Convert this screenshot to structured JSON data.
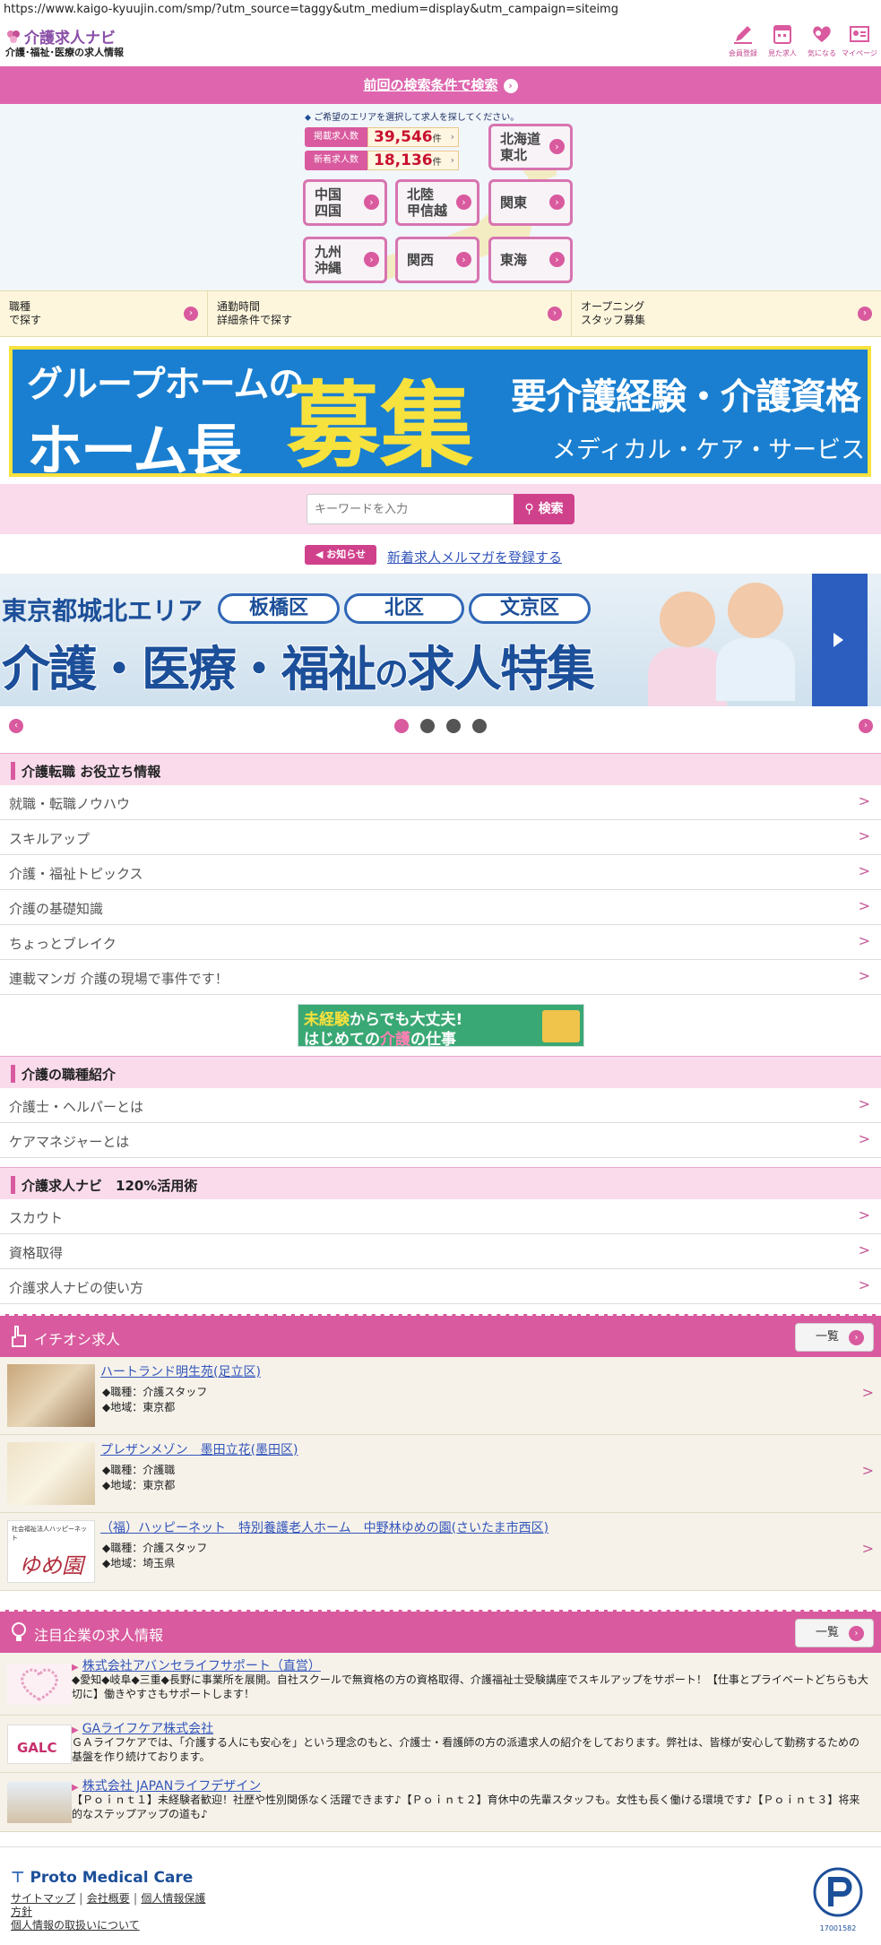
{
  "browser": {
    "url": "https://www.kaigo-kyuujin.com/smp/?utm_source=taggy&utm_medium=display&utm_campaign=siteimg"
  },
  "header": {
    "logo_title": "介護求人ナビ",
    "logo_sub": "介護･福祉･医療の求人情報",
    "icons": [
      {
        "icon": "pen-icon",
        "label": "会員登録"
      },
      {
        "icon": "calendar-icon",
        "label": "見た求人"
      },
      {
        "icon": "heart-icon",
        "label": "気になる"
      },
      {
        "icon": "profile-icon",
        "label": "マイページ"
      }
    ]
  },
  "prev_search": {
    "label": "前回の検索条件で検索"
  },
  "area": {
    "instruction": "ご希望のエリアを選択して求人を探してください。",
    "counts": [
      {
        "label": "掲載求人数",
        "value": "39,546",
        "unit": "件"
      },
      {
        "label": "新着求人数",
        "value": "18,136",
        "unit": "件"
      }
    ],
    "regions": [
      "北海道\n東北",
      "中国\n四国",
      "北陸\n甲信越",
      "関東",
      "九州\n沖縄",
      "関西",
      "東海"
    ]
  },
  "subnav": [
    {
      "label": "職種\nで探す"
    },
    {
      "label": "通勤時間\n詳細条件で探す"
    },
    {
      "label": "オープニング\nスタッフ募集"
    }
  ],
  "banner1": {
    "line1": "グループホームの",
    "line2": "ホーム長",
    "big": "募集",
    "requirement": "要介護経験・介護資格",
    "company": "メディカル・ケア・サービス"
  },
  "search": {
    "placeholder": "キーワードを入力",
    "button_label": "検索"
  },
  "news": {
    "badge": "お知らせ",
    "link": "新着求人メルマガを登録する"
  },
  "carousel": {
    "area_title": "東京都城北エリア",
    "pills": [
      "板橋区",
      "北区",
      "文京区"
    ],
    "main_a": "介護・医療・福祉",
    "main_b": "の",
    "main_c": "求人特集",
    "active_index": 0,
    "dot_count": 4
  },
  "section1": {
    "title": "介護転職 お役立ち情報",
    "items": [
      "就職・転職ノウハウ",
      "スキルアップ",
      "介護・福祉トピックス",
      "介護の基礎知識",
      "ちょっとブレイク",
      "連載マンガ 介護の現場で事件です！"
    ]
  },
  "mini_banner": {
    "l1a": "未経験",
    "l1b": "からでも大丈夫!",
    "l2a": "はじめての",
    "l2b": "介護",
    "l2c": "の仕事"
  },
  "section2": {
    "title": "介護の職種紹介",
    "items": [
      "介護士・ヘルパーとは",
      "ケアマネジャーとは"
    ]
  },
  "section3": {
    "title": "介護求人ナビ　120%活用術",
    "items": [
      "スカウト",
      "資格取得",
      "介護求人ナビの使い方"
    ]
  },
  "pickup": {
    "title": "イチオシ求人",
    "list_label": "一覧",
    "jobs": [
      {
        "title": "ハートランド明生苑(足立区)",
        "occupation": "◆職種：介護スタッフ",
        "region": "◆地域：東京都"
      },
      {
        "title": "プレザンメゾン　墨田立花(墨田区)",
        "occupation": "◆職種：介護職",
        "region": "◆地域：東京都"
      },
      {
        "title": "（福）ハッピーネット　特別養護老人ホーム　中野林ゆめの園(さいたま市西区)",
        "occupation": "◆職種：介護スタッフ",
        "region": "◆地域：埼玉県",
        "logo_text": "ゆめ園",
        "logo_caption": "社会福祉法人ハッピーネット"
      }
    ]
  },
  "featured": {
    "title": "注目企業の求人情報",
    "list_label": "一覧",
    "companies": [
      {
        "name": "株式会社アバンセライフサポート（直営）",
        "desc": "◆愛知◆岐阜◆三重◆長野に事業所を展開。自社スクールで無資格の方の資格取得、介護福祉士受験講座でスキルアップをサポート！【仕事とプライベートどちらも大切に】働きやすさもサポートします！"
      },
      {
        "name": "GAライフケア株式会社",
        "desc": "ＧＡライフケアでは、「介護する人にも安心を」という理念のもと、介護士・看護師の方の派遣求人の紹介をしております。弊社は、皆様が安心して勤務するための基盤を作り続けております。",
        "logo_text": "GALC"
      },
      {
        "name": "株式会社 JAPANライフデザイン",
        "desc": "【Ｐｏｉｎｔ１】未経験者歓迎！社歴や性別関係なく活躍できます♪【Ｐｏｉｎｔ２】育休中の先輩スタッフも。女性も長く働ける環境です♪【Ｐｏｉｎｔ３】将来的なステップアップの道も♪"
      }
    ]
  },
  "footer": {
    "brand": "Proto Medical Care",
    "links": [
      "サイトマップ",
      "会社概要",
      "個人情報保護",
      "方針",
      "個人情報の取扱いについて"
    ],
    "pmark_number": "17001582"
  },
  "colors": {
    "accent": "#d95a9e",
    "pink_light": "#f9dbec",
    "navy": "#1c4f99"
  }
}
